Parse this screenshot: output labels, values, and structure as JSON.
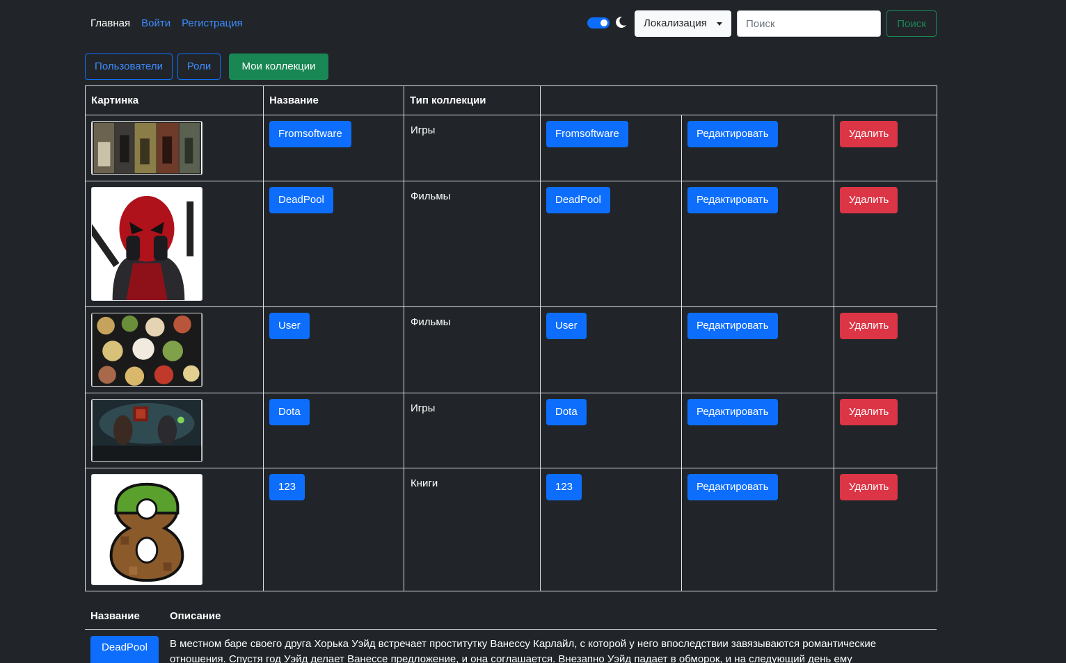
{
  "nav": {
    "home": "Главная",
    "login": "Войти",
    "register": "Регистрация",
    "localization": "Локализация",
    "search_placeholder": "Поиск",
    "search_button": "Поиск",
    "theme_dark_enabled": true
  },
  "tabs": {
    "users": "Пользователи",
    "roles": "Роли",
    "my_collections": "Мои коллекции"
  },
  "table": {
    "headers": {
      "image": "Картинка",
      "name": "Название",
      "type": "Тип коллекции"
    },
    "rows": [
      {
        "name": "Fromsoftware",
        "type": "Игры",
        "edit": "Редактировать",
        "delete": "Удалить",
        "image": "dark-souls-collage"
      },
      {
        "name": "DeadPool",
        "type": "Фильмы",
        "edit": "Редактировать",
        "delete": "Удалить",
        "image": "deadpool-portrait"
      },
      {
        "name": "User",
        "type": "Фильмы",
        "edit": "Редактировать",
        "delete": "Удалить",
        "image": "food-table"
      },
      {
        "name": "Dota",
        "type": "Игры",
        "edit": "Редактировать",
        "delete": "Удалить",
        "image": "dota-2-banner"
      },
      {
        "name": "123",
        "type": "Книги",
        "edit": "Редактировать",
        "delete": "Удалить",
        "image": "minecraft-number-8"
      }
    ]
  },
  "details": {
    "headers": {
      "name": "Название",
      "description": "Описание"
    },
    "name": "DeadPool",
    "description": "В местном баре своего друга Хорька Уэйд встречает проститутку Ванессу Карлайл, с которой у него впоследствии завязываются романтические отношения. Спустя год Уэйд делает Ванессе предложение, и она соглашается. Внезапно Уэйд падает в обморок, и на следующий день ему"
  },
  "colors": {
    "background": "#212529",
    "primary": "#0d6efd",
    "success": "#198754",
    "danger": "#dc3545"
  }
}
